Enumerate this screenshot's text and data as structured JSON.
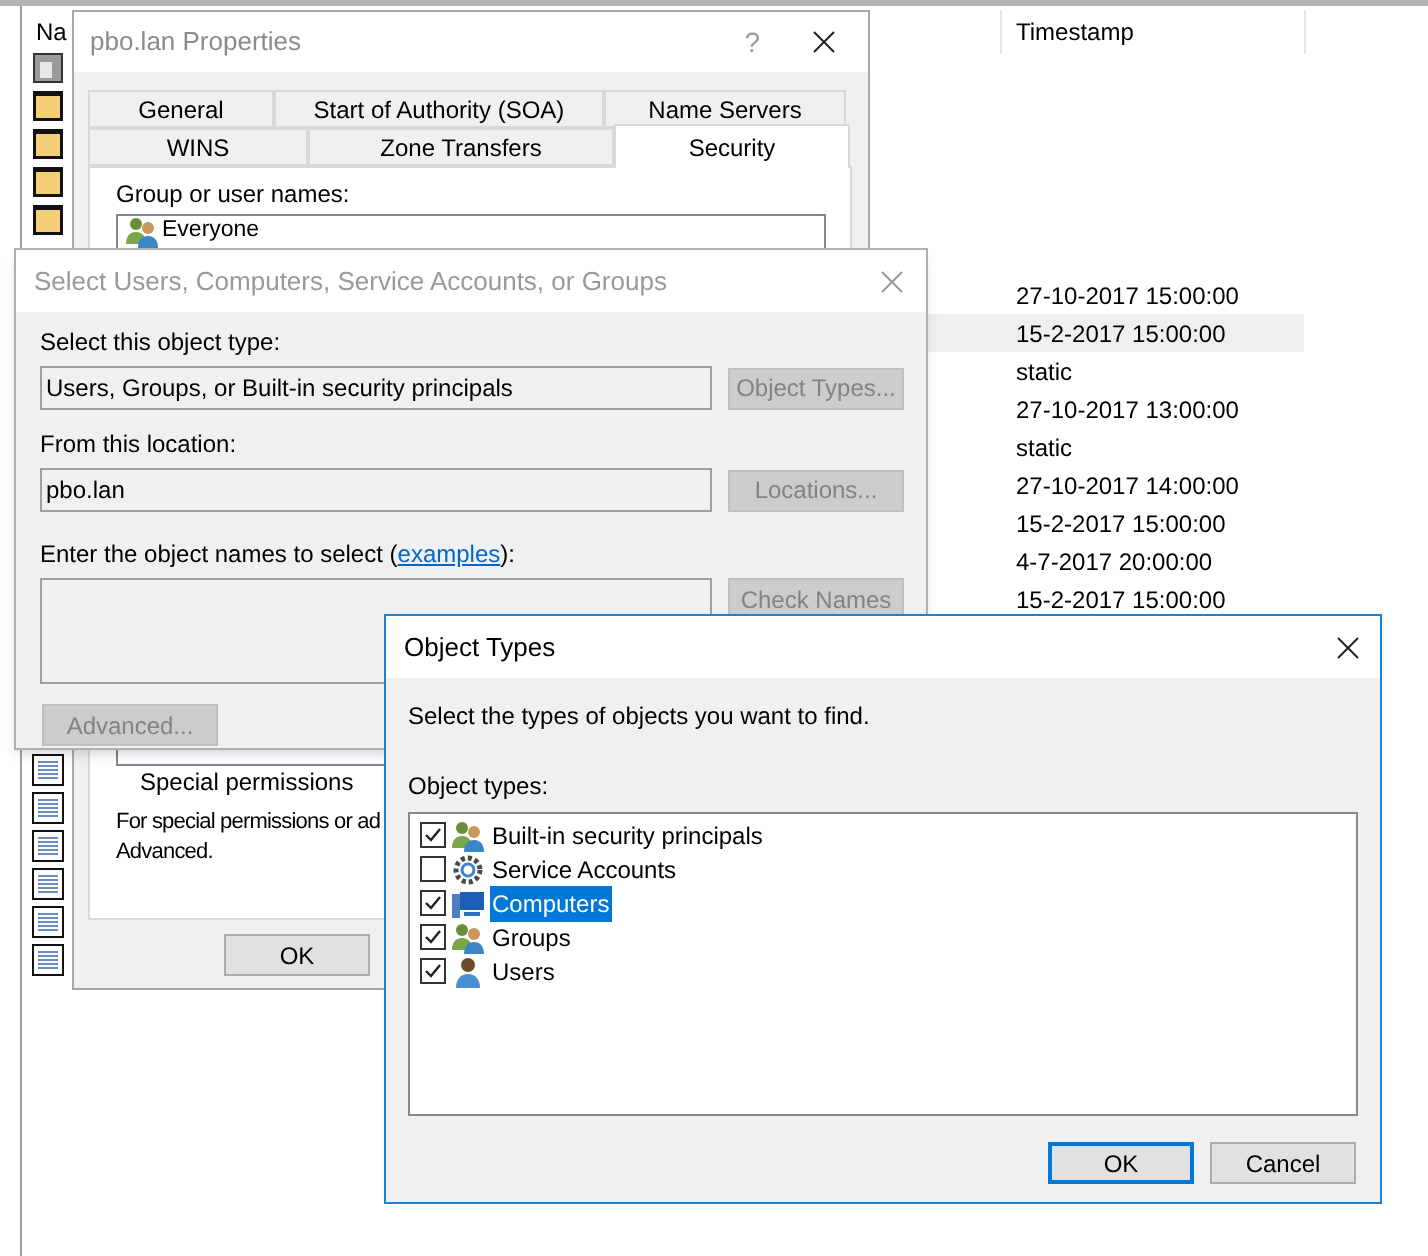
{
  "list_window": {
    "columns": [
      {
        "label": "Na"
      },
      {
        "label": "Timestamp"
      }
    ],
    "rows": [
      {
        "kind": "document",
        "selected": false
      },
      {
        "kind": "folder",
        "selected": false
      },
      {
        "kind": "folder",
        "selected": false
      },
      {
        "kind": "folder",
        "selected": false
      },
      {
        "kind": "folder",
        "selected": false
      },
      {},
      {
        "timestamp": "27-10-2017 15:00:00",
        "selected": false
      },
      {
        "timestamp": "15-2-2017 15:00:00",
        "selected": true
      },
      {
        "timestamp": "static",
        "selected": false
      },
      {
        "timestamp": "27-10-2017 13:00:00",
        "selected": false
      },
      {
        "timestamp": "static",
        "selected": false
      },
      {
        "timestamp": "27-10-2017 14:00:00",
        "selected": false
      },
      {
        "timestamp": "15-2-2017 15:00:00",
        "selected": false
      },
      {
        "timestamp": "4-7-2017 20:00:00",
        "selected": false
      },
      {
        "timestamp": "15-2-2017 15:00:00",
        "selected": false
      },
      {},
      {},
      {},
      {
        "kind": "record",
        "selected": false
      },
      {
        "kind": "record",
        "selected": false
      },
      {
        "kind": "record",
        "selected": false
      },
      {
        "kind": "record",
        "selected": false
      },
      {
        "kind": "record",
        "selected": false
      },
      {
        "kind": "record",
        "selected": false
      }
    ]
  },
  "properties_dialog": {
    "title": "pbo.lan Properties",
    "help": "?",
    "tab_rows": [
      [
        {
          "label": "General",
          "selected": false
        },
        {
          "label": "Start of Authority (SOA)",
          "selected": false
        },
        {
          "label": "Name Servers",
          "selected": false
        }
      ],
      [
        {
          "label": "WINS",
          "selected": false
        },
        {
          "label": "Zone Transfers",
          "selected": false
        },
        {
          "label": "Security",
          "selected": true
        }
      ]
    ],
    "group_label": "Group or user names:",
    "principals": [
      {
        "name": "Everyone"
      }
    ],
    "permission_entry": "Special permissions",
    "note_lines": [
      "For special permissions or ad",
      "Advanced."
    ],
    "ok": "OK"
  },
  "select_dialog": {
    "title": "Select Users, Computers, Service Accounts, or Groups",
    "object_type_label": "Select this object type:",
    "object_type_value": "Users, Groups, or Built-in security principals",
    "object_types_button": {
      "label": "Object Types...",
      "disabled": true
    },
    "location_label": "From this location:",
    "location_value": "pbo.lan",
    "locations_button": {
      "label": "Locations...",
      "disabled": true
    },
    "names_label_before": "Enter the object names to select (",
    "names_link": "examples",
    "names_label_after": "):",
    "check_names_button": {
      "label": "Check Names",
      "disabled": true
    },
    "advanced_button": {
      "label": "Advanced...",
      "disabled": true
    }
  },
  "object_types_dialog": {
    "title": "Object Types",
    "description": "Select the types of objects you want to find.",
    "list_label": "Object types:",
    "items": [
      {
        "label": "Built-in security principals",
        "kind": "group",
        "checked": true,
        "selected": false
      },
      {
        "label": "Service Accounts",
        "kind": "gear",
        "checked": false,
        "selected": false
      },
      {
        "label": "Computers",
        "kind": "computer",
        "checked": true,
        "selected": true
      },
      {
        "label": "Groups",
        "kind": "group",
        "checked": true,
        "selected": false
      },
      {
        "label": "Users",
        "kind": "user",
        "checked": true,
        "selected": false
      }
    ],
    "buttons": [
      {
        "label": "OK",
        "default": true
      },
      {
        "label": "Cancel",
        "default": false
      }
    ]
  }
}
